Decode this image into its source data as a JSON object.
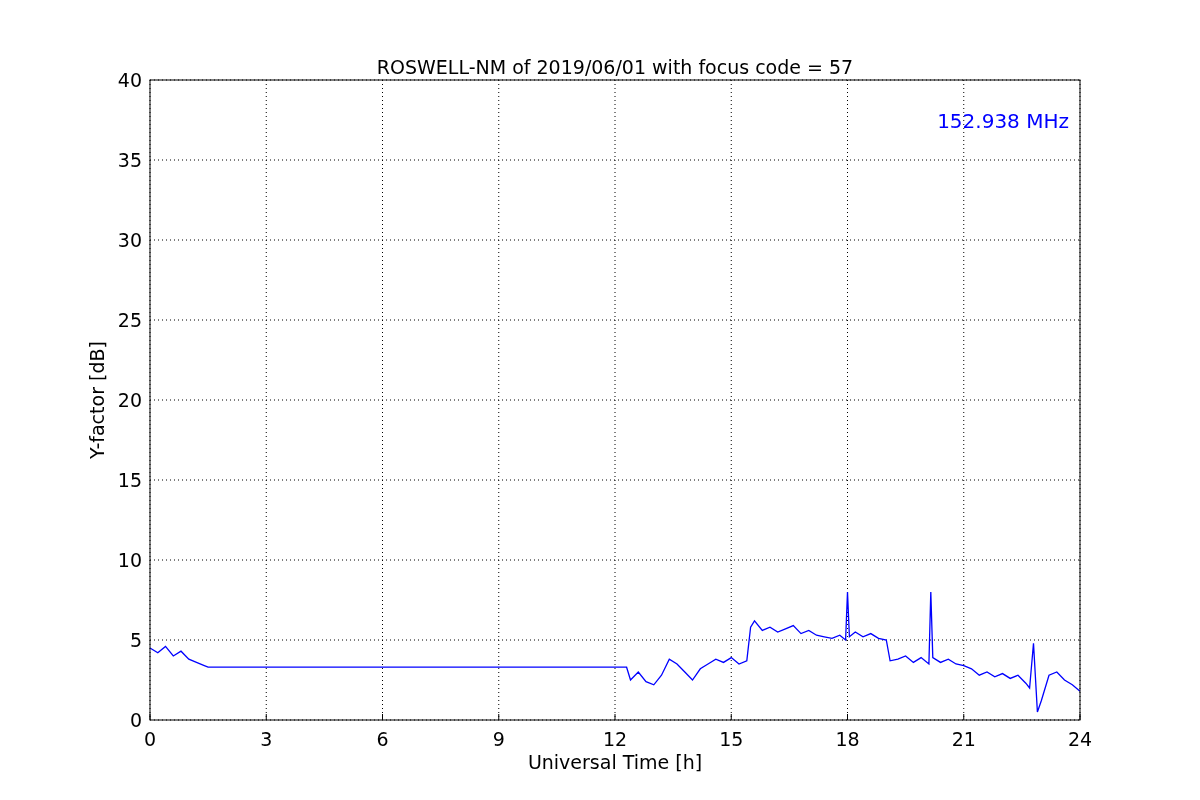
{
  "chart_data": {
    "type": "line",
    "title": "ROSWELL-NM of 2019/06/01 with focus code = 57",
    "xlabel": "Universal Time [h]",
    "ylabel": "Y-factor [dB]",
    "x": [
      0,
      0.2,
      0.4,
      0.6,
      0.8,
      1.0,
      1.2,
      1.4,
      1.5,
      12.3,
      12.4,
      12.6,
      12.8,
      13.0,
      13.2,
      13.4,
      13.6,
      13.8,
      14.0,
      14.2,
      14.4,
      14.6,
      14.8,
      15.0,
      15.2,
      15.4,
      15.5,
      15.6,
      15.8,
      16.0,
      16.2,
      16.4,
      16.6,
      16.8,
      17.0,
      17.2,
      17.4,
      17.6,
      17.8,
      17.95,
      18.0,
      18.05,
      18.2,
      18.4,
      18.6,
      18.8,
      19.0,
      19.1,
      19.3,
      19.5,
      19.7,
      19.9,
      20.1,
      20.15,
      20.2,
      20.4,
      20.6,
      20.8,
      21.0,
      21.2,
      21.4,
      21.6,
      21.8,
      22.0,
      22.2,
      22.4,
      22.6,
      22.7,
      22.8,
      22.9,
      23.0,
      23.2,
      23.4,
      23.6,
      23.8,
      24.0
    ],
    "series": [
      {
        "name": "152.938 MHz",
        "color": "#0000ff",
        "values": [
          4.5,
          4.2,
          4.6,
          4.0,
          4.3,
          3.8,
          3.6,
          3.4,
          3.3,
          3.3,
          2.5,
          3.0,
          2.4,
          2.2,
          2.8,
          3.8,
          3.5,
          3.0,
          2.5,
          3.2,
          3.5,
          3.8,
          3.6,
          3.9,
          3.5,
          3.7,
          5.8,
          6.2,
          5.6,
          5.8,
          5.5,
          5.7,
          5.9,
          5.4,
          5.6,
          5.3,
          5.2,
          5.1,
          5.3,
          5.0,
          8.0,
          5.2,
          5.5,
          5.2,
          5.4,
          5.1,
          5.0,
          3.7,
          3.8,
          4.0,
          3.6,
          3.9,
          3.5,
          8.0,
          3.9,
          3.6,
          3.8,
          3.5,
          3.4,
          3.2,
          2.8,
          3.0,
          2.7,
          2.9,
          2.6,
          2.8,
          2.3,
          2.0,
          4.8,
          0.5,
          1.2,
          2.8,
          3.0,
          2.5,
          2.2,
          1.8
        ]
      }
    ],
    "xlim": [
      0,
      24
    ],
    "ylim": [
      0,
      40
    ],
    "xticks": [
      0,
      3,
      6,
      9,
      12,
      15,
      18,
      21,
      24
    ],
    "yticks": [
      0,
      5,
      10,
      15,
      20,
      25,
      30,
      35,
      40
    ],
    "grid": true
  }
}
